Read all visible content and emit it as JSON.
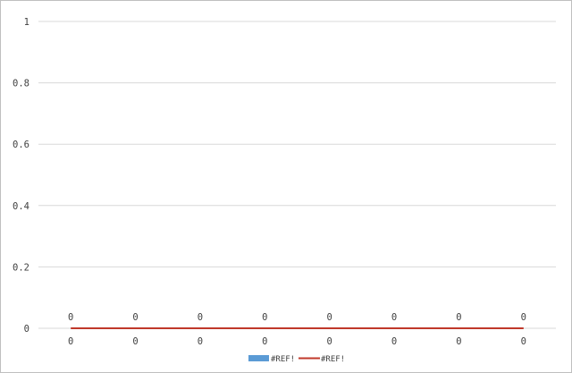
{
  "chart_data": {
    "type": "bar",
    "categories": [
      "0",
      "0",
      "0",
      "0",
      "0",
      "0",
      "0",
      "0"
    ],
    "series": [
      {
        "name": "#REF!",
        "type": "bar",
        "values": [
          0,
          0,
          0,
          0,
          0,
          0,
          0,
          0
        ]
      },
      {
        "name": "#REF!",
        "type": "line",
        "values": [
          0,
          0,
          0,
          0,
          0,
          0,
          0,
          0
        ]
      }
    ],
    "data_labels": [
      "0",
      "0",
      "0",
      "0",
      "0",
      "0",
      "0",
      "0"
    ],
    "y_ticks": [
      "0",
      "0.2",
      "0.4",
      "0.6",
      "0.8",
      "1"
    ],
    "ylim": [
      0,
      1
    ],
    "title": "",
    "xlabel": "",
    "ylabel": "",
    "grid": true,
    "legend_position": "bottom",
    "colors": {
      "bar": "#5b9bd5",
      "line": "#c0392b",
      "grid": "#d9d9d9",
      "border": "#bfbfbf"
    }
  }
}
